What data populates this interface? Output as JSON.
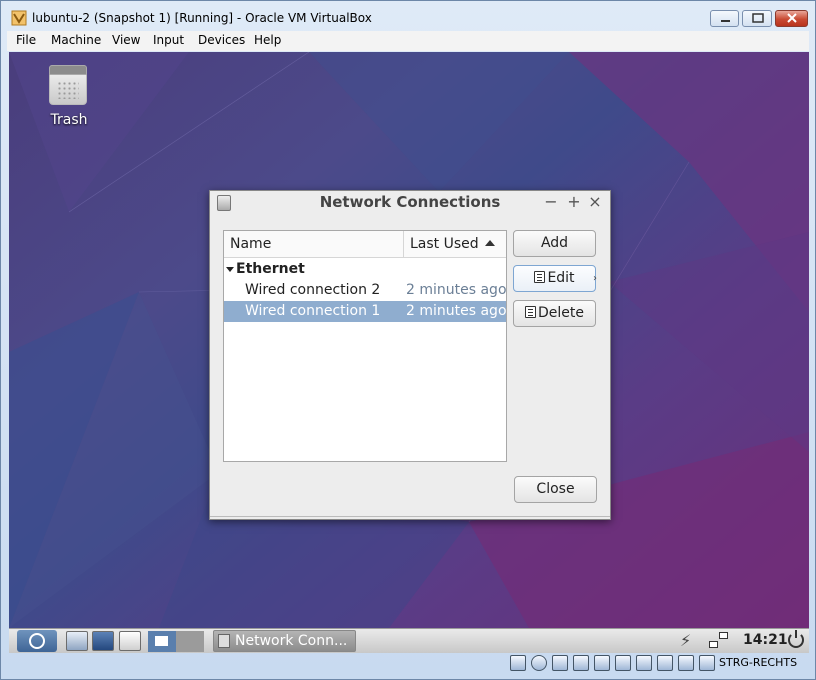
{
  "host": {
    "title": "lubuntu-2 (Snapshot 1) [Running] - Oracle VM VirtualBox",
    "menu": [
      "File",
      "Machine",
      "View",
      "Input",
      "Devices",
      "Help"
    ],
    "status_key": "STRG-RECHTS"
  },
  "desktop": {
    "icons": [
      {
        "label": "Trash",
        "icon": "trash-icon"
      }
    ]
  },
  "dialog": {
    "title": "Network Connections",
    "columns": {
      "name": "Name",
      "last_used": "Last Used"
    },
    "group": "Ethernet",
    "rows": [
      {
        "name": "Wired connection 2",
        "last_used": "2 minutes ago",
        "selected": false
      },
      {
        "name": "Wired connection 1",
        "last_used": "2 minutes ago",
        "selected": true
      }
    ],
    "buttons": {
      "add": "Add",
      "edit": "Edit",
      "delete": "Delete",
      "close": "Close"
    }
  },
  "panel": {
    "task_label": "Network Conn...",
    "clock": "14:21"
  },
  "colors": {
    "selection": "#8fadcf",
    "panel_start": "#3f6596"
  }
}
